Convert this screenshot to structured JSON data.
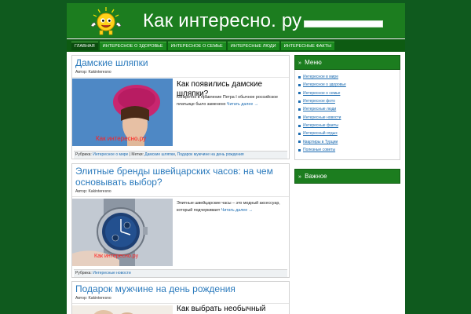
{
  "site": {
    "title": "Как интересно. ру",
    "colors": {
      "brand": "#1c7d1f",
      "background": "#0f5a1e",
      "link": "#2c7bbd"
    }
  },
  "nav": [
    {
      "label": "Главная"
    },
    {
      "label": "Интересное о здоровье"
    },
    {
      "label": "Интересное о семье"
    },
    {
      "label": "Интересные люди"
    },
    {
      "label": "Интересные факты"
    }
  ],
  "posts": [
    {
      "title": "Дамские шляпки",
      "author": "Автор: Kakinteresno",
      "subtitle": "Как появились дамские шляпки?",
      "excerpt": "Конкретно в правление Петра I обычное российское платьице было заменено",
      "read_more": "Читать далее →",
      "watermark": "Как интересно.ру",
      "meta": {
        "rubric_label": "Рубрика:",
        "rubric": "Интересное о мире",
        "tags_label": "| Метки:",
        "tags": [
          "Дамские шляпки",
          "Подарок мужчине на день рождения"
        ]
      }
    },
    {
      "title": "Элитные бренды швейцарских часов: на чем основывать выбор?",
      "author": "Автор: Kakinteresno",
      "excerpt": "Элитные швейцарские часы – это модный аксессуар, который подчеркивает",
      "read_more": "Читать далее →",
      "watermark": "Как интересно.ру",
      "meta": {
        "rubric_label": "Рубрика:",
        "rubric": "Интересные новости"
      }
    },
    {
      "title": "Подарок мужчине на день рождения",
      "author": "Автор: Kakinteresno",
      "subtitle": "Как выбрать необычный"
    }
  ],
  "sidebar": {
    "menu": {
      "title": "Меню",
      "items": [
        "Интересное в мире",
        "Интересное о здоровье",
        "Интересное о семье",
        "Интересное фото",
        "Интересные люди",
        "Интересные новости",
        "Интересные факты",
        "Интересный отдых",
        "Квартиры в Турции",
        "Полезные советы"
      ]
    },
    "important": {
      "title": "Важное"
    }
  },
  "icons": {
    "logo": "smiley-thumbs-up-icon",
    "widget_arrow": "double-chevron-right-icon"
  }
}
